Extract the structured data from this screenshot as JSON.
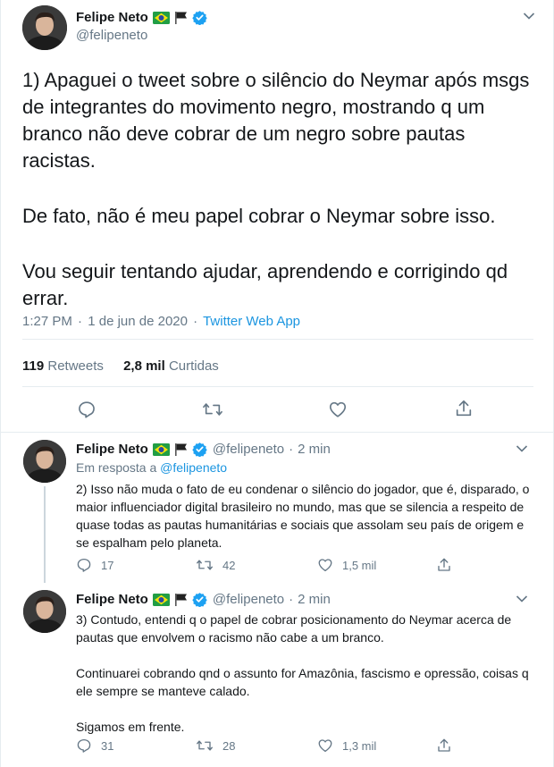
{
  "main_tweet": {
    "author_name": "Felipe Neto",
    "handle": "@felipeneto",
    "text_lines": {
      "p1": "1) Apaguei o tweet sobre o silêncio do Neymar após msgs de integrantes do movimento negro, mostrando q um branco não deve cobrar de um negro sobre pautas racistas.",
      "p2": "De fato, não é meu papel cobrar o Neymar sobre isso.",
      "p3": "Vou seguir tentando ajudar, aprendendo e corrigindo qd errar."
    },
    "time": "1:27 PM",
    "date": "1 de jun de 2020",
    "source": "Twitter Web App",
    "retweets_count": "119",
    "retweets_label": "Retweets",
    "likes_count": "2,8 mil",
    "likes_label": "Curtidas",
    "icons": [
      "reply-icon",
      "retweet-icon",
      "like-icon",
      "share-icon"
    ]
  },
  "replies": [
    {
      "author_name": "Felipe Neto",
      "handle": "@felipeneto",
      "age": "2 min",
      "replying_to_prefix": "Em resposta a",
      "replying_to_handle": "@felipeneto",
      "text": "2) Isso não muda o fato de eu condenar o silêncio do jogador, que é, disparado, o maior influenciador digital brasileiro no mundo, mas que se silencia a respeito de quase todas as pautas humanitárias e sociais que assolam seu país de origem e se espalham pelo planeta.",
      "replies_count": "17",
      "retweets_count": "42",
      "likes_count": "1,5 mil"
    },
    {
      "author_name": "Felipe Neto",
      "handle": "@felipeneto",
      "age": "2 min",
      "text_p1": "3) Contudo, entendi q o papel de cobrar posicionamento do Neymar acerca de pautas que envolvem o racismo não cabe a um branco.",
      "text_p2": "Continuarei cobrando qnd o assunto for Amazônia, fascismo e opressão, coisas q ele sempre se manteve calado.",
      "text_p3": "Sigamos em frente.",
      "replies_count": "31",
      "retweets_count": "28",
      "likes_count": "1,3 mil"
    }
  ],
  "colors": {
    "text": "#14171a",
    "secondary": "#657786",
    "link": "#1b95e0",
    "verified": "#1da1f2",
    "border": "#e6ecf0"
  },
  "meta_separator": "·"
}
